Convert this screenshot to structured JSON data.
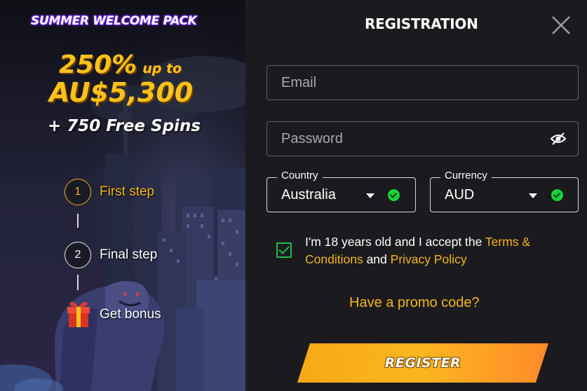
{
  "promo": {
    "badge": "SUMMER WELCOME PACK",
    "percent": "250%",
    "up_to": "up to",
    "amount": "AU$5,300",
    "free_spins": "+ 750 Free Spins",
    "steps": [
      {
        "number": "1",
        "label": "First step"
      },
      {
        "number": "2",
        "label": "Final step"
      },
      {
        "icon": "gift-icon",
        "label": "Get bonus"
      }
    ]
  },
  "form": {
    "title": "REGISTRATION",
    "email": {
      "placeholder": "Email",
      "value": ""
    },
    "password": {
      "placeholder": "Password",
      "value": ""
    },
    "country": {
      "legend": "Country",
      "value": "Australia"
    },
    "currency": {
      "legend": "Currency",
      "value": "AUD"
    },
    "consent": {
      "text": "I'm 18 years old and I accept the",
      "terms_link": "Terms & Conditions",
      "and": "and",
      "privacy_link": "Privacy Policy",
      "checked": true
    },
    "promo_code_link": "Have a promo code?",
    "register_button": "REGISTER"
  },
  "colors": {
    "accent": "#f5b51b",
    "background": "#1b1b1f",
    "success": "#18d43a"
  }
}
